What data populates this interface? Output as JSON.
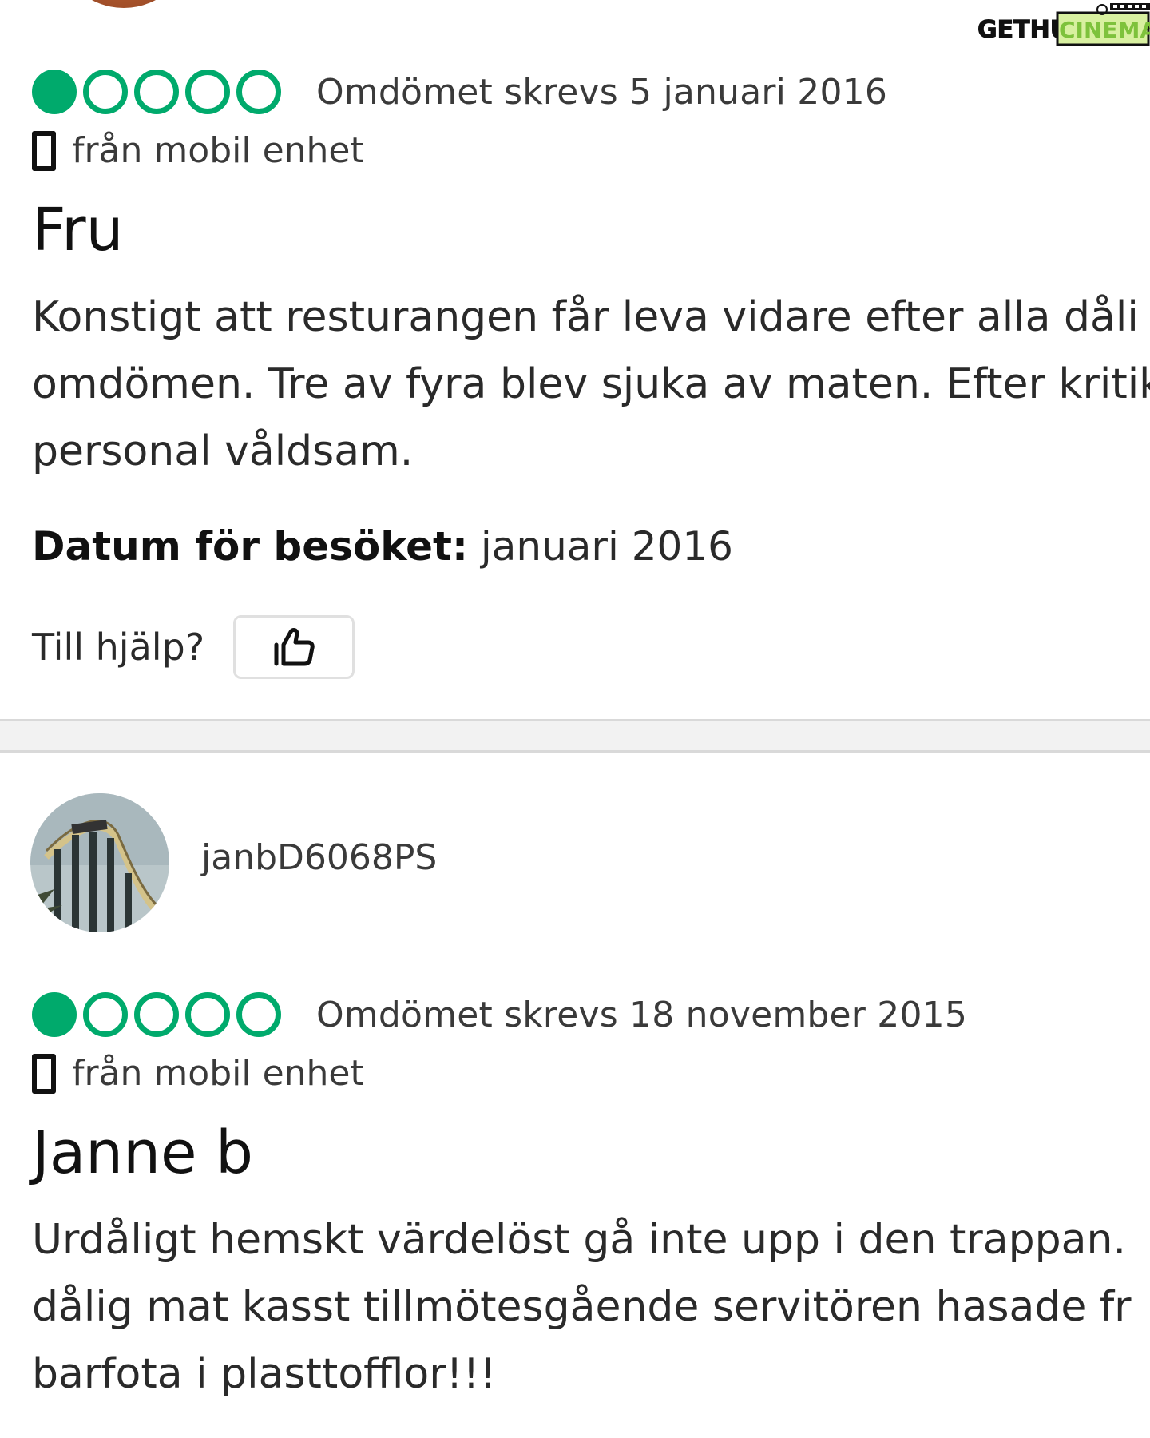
{
  "watermark": {
    "part1": "GETHU",
    "part2": "CINEMA"
  },
  "reviews": [
    {
      "rating": 1,
      "rating_max": 5,
      "written": "Omdömet skrevs 5 januari 2016",
      "device": "från mobil enhet",
      "title": "Fru",
      "body_lines": [
        "Konstigt att resturangen får leva vidare efter alla dåli",
        "omdömen. Tre av fyra blev sjuka av maten. Efter kritik",
        "personal våldsam."
      ],
      "visit_label": "Datum för besöket:",
      "visit_value": " januari 2016",
      "helpful_label": "Till hjälp?"
    },
    {
      "username": "janbD6068PS",
      "rating": 1,
      "rating_max": 5,
      "written": "Omdömet skrevs 18 november 2015",
      "device": "från mobil enhet",
      "title": "Janne b",
      "body_lines": [
        "Urdåligt hemskt värdelöst gå inte upp i den trappan.",
        "dålig mat kasst tillmötesgående servitören hasade fr",
        "barfota i plasttofflor!!!"
      ]
    }
  ],
  "icons": {
    "thumb": "thumbs-up-icon",
    "phone": "mobile-phone-icon",
    "bubble_color": "#00aa6c"
  }
}
